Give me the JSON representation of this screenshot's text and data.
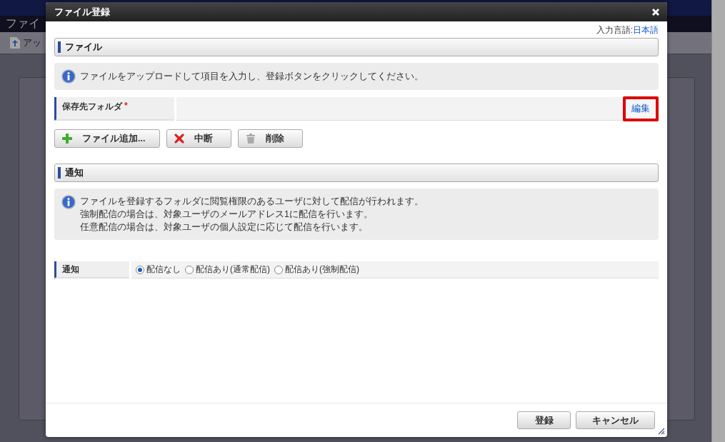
{
  "background": {
    "page_title": "ファイ",
    "toolbar_button": "アッ"
  },
  "dialog": {
    "title": "ファイル登録",
    "input_language_label": "入力言語:",
    "input_language": "日本語",
    "file_section": {
      "heading": "ファイル",
      "info": "ファイルをアップロードして項目を入力し、登録ボタンをクリックしてください。",
      "folder_field": {
        "label": "保存先フォルダ",
        "required_mark": "*",
        "edit_link": "編集",
        "highlighted": true
      },
      "buttons": [
        {
          "label": "ファイル追加...",
          "kind": "add"
        },
        {
          "label": "中断",
          "kind": "stop"
        },
        {
          "label": "削除",
          "kind": "delete"
        }
      ]
    },
    "notice_section": {
      "heading": "通知",
      "info_lines": [
        "ファイルを登録するフォルダに閲覧権限のあるユーザに対して配信が行われます。",
        "強制配信の場合は、対象ユーザのメールアドレス1に配信を行います。",
        "任意配信の場合は、対象ユーザの個人設定に応じて配信を行います。"
      ],
      "field_label": "通知",
      "options": [
        {
          "label": "配信なし",
          "selected": true
        },
        {
          "label": "配信あり(通常配信)",
          "selected": false
        },
        {
          "label": "配信あり(強制配信)",
          "selected": false
        }
      ]
    },
    "footer_buttons": [
      "登録",
      "キャンセル"
    ]
  }
}
